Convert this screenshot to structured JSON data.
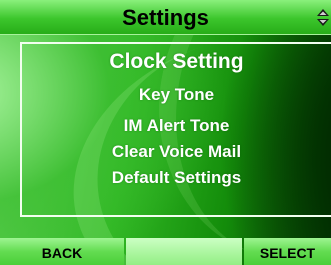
{
  "header": {
    "title": "Settings",
    "scroll_icon": "up-down-arrows-icon"
  },
  "menu": {
    "items": [
      {
        "label": "Clock Setting",
        "selected": true
      },
      {
        "label": "Key Tone",
        "selected": false
      },
      {
        "label": "IM Alert Tone",
        "selected": false
      },
      {
        "label": "Clear Voice Mail",
        "selected": false
      },
      {
        "label": "Default Settings",
        "selected": false
      }
    ]
  },
  "softkeys": {
    "left": "BACK",
    "middle": "",
    "right": "SELECT"
  },
  "colors": {
    "title_bar": "#3cc62c",
    "softkey_bar": "#63dc51",
    "softkey_middle": "#a8f59c",
    "menu_text": "#ffffff",
    "background_dark": "#053d02",
    "background_light": "#64d258"
  }
}
